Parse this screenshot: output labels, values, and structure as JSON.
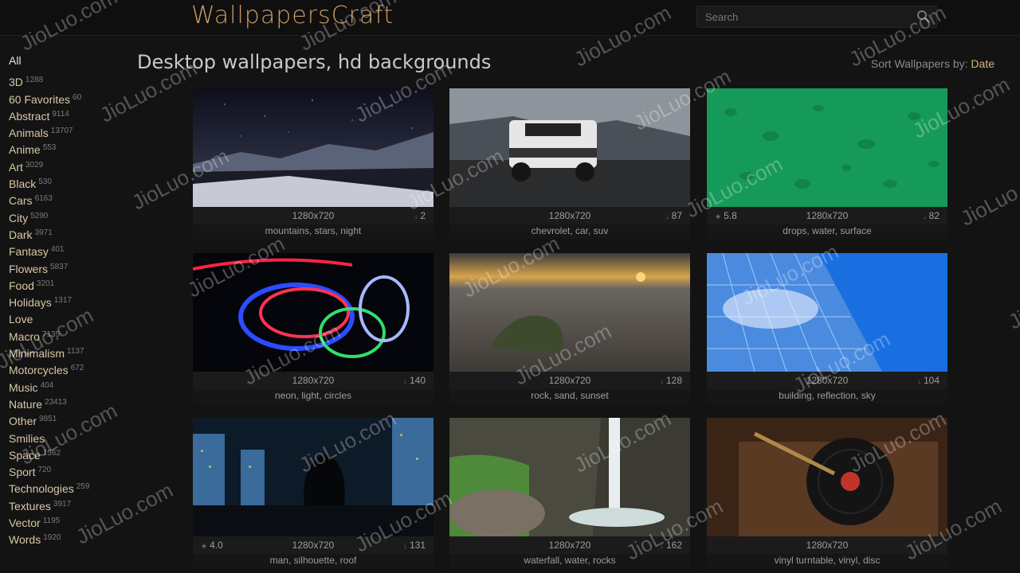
{
  "site": {
    "logo": "WallpapersCraft"
  },
  "search": {
    "placeholder": "Search"
  },
  "page": {
    "title": "Desktop wallpapers, hd backgrounds",
    "sort_label": "Sort Wallpapers by:",
    "sort_value": "Date"
  },
  "sidebar": {
    "all": "All",
    "categories": [
      {
        "label": "3D",
        "count": "1288"
      },
      {
        "label": "60 Favorites",
        "count": "60"
      },
      {
        "label": "Abstract",
        "count": "9114"
      },
      {
        "label": "Animals",
        "count": "13707"
      },
      {
        "label": "Anime",
        "count": "553"
      },
      {
        "label": "Art",
        "count": "3029"
      },
      {
        "label": "Black",
        "count": "530"
      },
      {
        "label": "Cars",
        "count": "6163"
      },
      {
        "label": "City",
        "count": "5290"
      },
      {
        "label": "Dark",
        "count": "3971"
      },
      {
        "label": "Fantasy",
        "count": "401"
      },
      {
        "label": "Flowers",
        "count": "5837"
      },
      {
        "label": "Food",
        "count": "3201"
      },
      {
        "label": "Holidays",
        "count": "1317"
      },
      {
        "label": "Love",
        "count": ""
      },
      {
        "label": "Macro",
        "count": "7135"
      },
      {
        "label": "Minimalism",
        "count": "1137"
      },
      {
        "label": "Motorcycles",
        "count": "672"
      },
      {
        "label": "Music",
        "count": "404"
      },
      {
        "label": "Nature",
        "count": "23413"
      },
      {
        "label": "Other",
        "count": "9851"
      },
      {
        "label": "Smilies",
        "count": ""
      },
      {
        "label": "Space",
        "count": "1562"
      },
      {
        "label": "Sport",
        "count": "720"
      },
      {
        "label": "Technologies",
        "count": "259"
      },
      {
        "label": "Textures",
        "count": "3917"
      },
      {
        "label": "Vector",
        "count": "1195"
      },
      {
        "label": "Words",
        "count": "1920"
      }
    ]
  },
  "wallpapers": [
    {
      "resolution": "1280x720",
      "rating": "",
      "downloads": "2",
      "tags": "mountains, stars, night",
      "theme": "mountains"
    },
    {
      "resolution": "1280x720",
      "rating": "",
      "downloads": "87",
      "tags": "chevrolet, car, suv",
      "theme": "truck"
    },
    {
      "resolution": "1280x720",
      "rating": "5.8",
      "downloads": "82",
      "tags": "drops, water, surface",
      "theme": "drops"
    },
    {
      "resolution": "1280x720",
      "rating": "",
      "downloads": "140",
      "tags": "neon, light, circles",
      "theme": "neon"
    },
    {
      "resolution": "1280x720",
      "rating": "",
      "downloads": "128",
      "tags": "rock, sand, sunset",
      "theme": "beach"
    },
    {
      "resolution": "1280x720",
      "rating": "",
      "downloads": "104",
      "tags": "building, reflection, sky",
      "theme": "building"
    },
    {
      "resolution": "1280x720",
      "rating": "4.0",
      "downloads": "131",
      "tags": "man, silhouette, roof",
      "theme": "city"
    },
    {
      "resolution": "1280x720",
      "rating": "",
      "downloads": "162",
      "tags": "waterfall, water, rocks",
      "theme": "waterfall"
    },
    {
      "resolution": "1280x720",
      "rating": "",
      "downloads": "",
      "tags": "vinyl turntable, vinyl, disc",
      "theme": "vinyl"
    }
  ],
  "watermark": "JioLuo.com",
  "colors": {
    "accent": "#d8b47a",
    "logo": "#c99a63",
    "background": "#131313"
  }
}
